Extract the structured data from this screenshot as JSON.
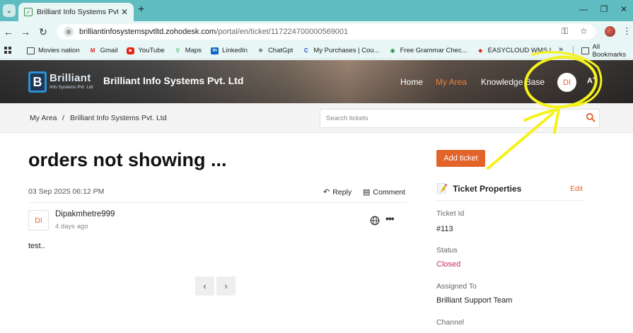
{
  "browser": {
    "tab_title": "Brilliant Info Systems Pvt. Ltd | T",
    "url_host": "brilliantinfosystemspvtltd.zohodesk.com",
    "url_path": "/portal/en/ticket/117224700000569001",
    "bookmarks": [
      "Movies nation",
      "Gmail",
      "YouTube",
      "Maps",
      "LinkedIn",
      "ChatGpt",
      "My Purchases | Cou...",
      "Free Grammar Chec...",
      "EASYCLOUD WMS L..."
    ],
    "more_bookmarks": "»",
    "all_bookmarks": "All Bookmarks"
  },
  "header": {
    "logo_word": "Brilliant",
    "logo_sub": "Info Systems Pvt. Ltd",
    "company": "Brilliant Info Systems Pvt. Ltd",
    "nav": [
      "Home",
      "My Area",
      "Knowledge Base"
    ],
    "avatar": "DI",
    "font_toggle": "A"
  },
  "breadcrumb": {
    "root": "My Area",
    "separator": "/",
    "current": "Brilliant Info Systems Pvt. Ltd"
  },
  "search": {
    "placeholder": "Search tickets"
  },
  "ticket": {
    "title": "orders not showing ...",
    "date": "03 Sep 2025 06:12 PM",
    "reply_label": "Reply",
    "comment_label": "Comment",
    "author_initials": "DI",
    "author": "Dipakmhetre999",
    "author_time": "4 days ago",
    "body": "test.."
  },
  "sidebar": {
    "add_ticket": "Add ticket",
    "properties_title": "Ticket Properties",
    "edit_label": "Edit",
    "properties": [
      {
        "label": "Ticket Id",
        "value": "#113"
      },
      {
        "label": "Status",
        "value": "Closed"
      },
      {
        "label": "Assigned To",
        "value": "Brilliant Support Team"
      },
      {
        "label": "Channel",
        "value": ""
      }
    ]
  },
  "colors": {
    "accent": "#e2642b",
    "status_closed": "#c32a62",
    "annotation": "#f5f21a"
  }
}
